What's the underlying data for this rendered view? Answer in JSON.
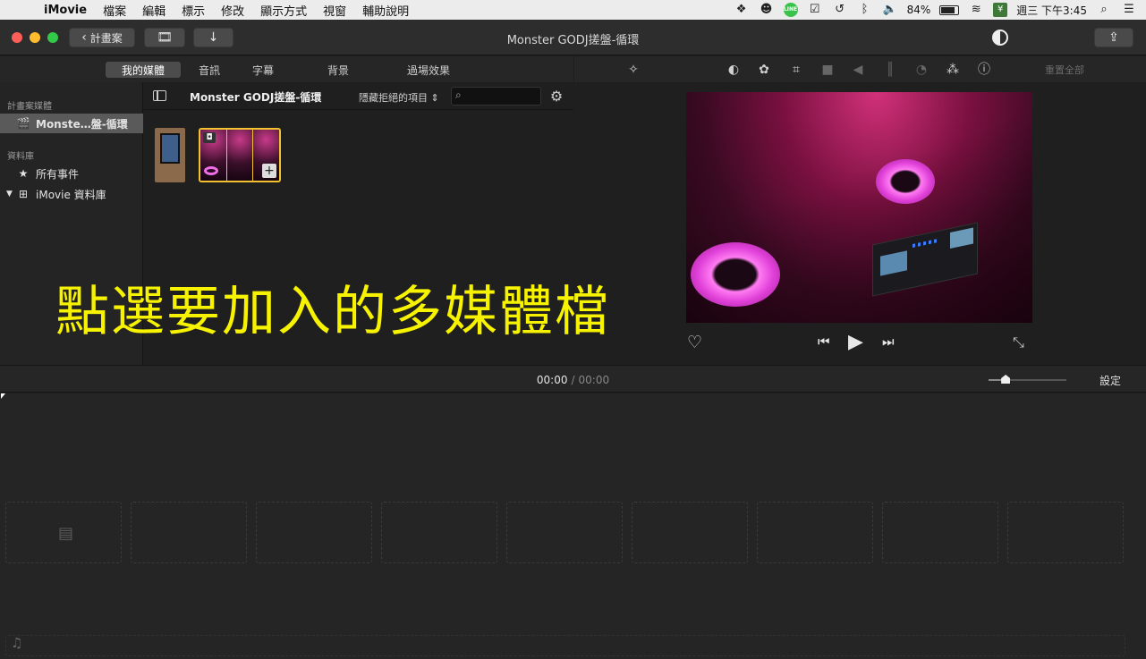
{
  "menubar": {
    "app_name": "iMovie",
    "items": [
      "檔案",
      "編輯",
      "標示",
      "修改",
      "顯示方式",
      "視窗",
      "輔助說明"
    ],
    "battery_percent": "84%",
    "battery_level": 0.84,
    "clock": "週三 下午3:45",
    "line_label": "LINE"
  },
  "toolbar": {
    "back_label": "計畫案",
    "window_title": "Monster GODJ搓盤-循環"
  },
  "browser_tabs": [
    {
      "label": "我的媒體",
      "active": true
    },
    {
      "label": "音訊",
      "active": false
    },
    {
      "label": "字幕",
      "active": false
    },
    {
      "label": "背景",
      "active": false
    },
    {
      "label": "過場效果",
      "active": false
    }
  ],
  "viewer_tools": {
    "reset_label": "重置全部"
  },
  "sidebar": {
    "project_media_header": "計畫案媒體",
    "project_item": "Monste…盤-循環",
    "library_header": "資料庫",
    "all_events": "所有事件",
    "library_item": "iMovie 資料庫"
  },
  "browser": {
    "title": "Monster GODJ搓盤-循環",
    "filter_label": "隱藏拒絕的項目",
    "search_value": ""
  },
  "caption": "點選要加入的多媒體檔",
  "timeline": {
    "current_time": "00:00",
    "separator": "/",
    "duration": "00:00",
    "settings_label": "設定",
    "zoom_level": 0.22
  }
}
